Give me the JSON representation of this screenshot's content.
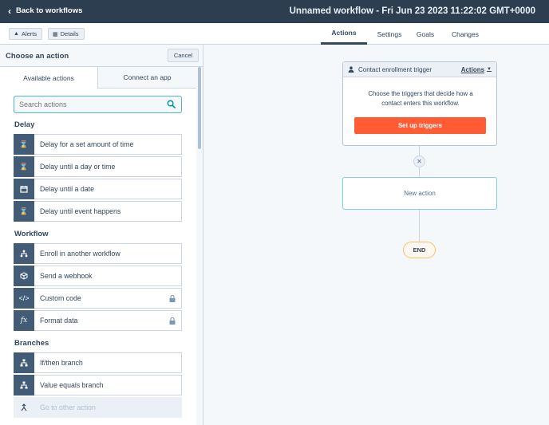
{
  "topbar": {
    "back_label": "Back to workflows",
    "workflow_title": "Unnamed workflow - Fri Jun 23 2023 11:22:02 GMT+0000"
  },
  "subbar": {
    "alerts_label": "Alerts",
    "details_label": "Details",
    "tabs": [
      {
        "label": "Actions",
        "active": true
      },
      {
        "label": "Settings",
        "active": false
      },
      {
        "label": "Goals",
        "active": false
      },
      {
        "label": "Changes",
        "active": false
      }
    ]
  },
  "panel": {
    "title": "Choose an action",
    "cancel_label": "Cancel",
    "tabs": [
      {
        "label": "Available actions",
        "active": true
      },
      {
        "label": "Connect an app",
        "active": false
      }
    ],
    "search_placeholder": "Search actions",
    "sections": [
      {
        "label": "Delay",
        "items": [
          {
            "label": "Delay for a set amount of time",
            "icon": "hourglass-icon",
            "locked": false,
            "disabled": false
          },
          {
            "label": "Delay until a day or time",
            "icon": "hourglass-icon",
            "locked": false,
            "disabled": false
          },
          {
            "label": "Delay until a date",
            "icon": "calendar-icon",
            "locked": false,
            "disabled": false
          },
          {
            "label": "Delay until event happens",
            "icon": "hourglass-icon",
            "locked": false,
            "disabled": false
          }
        ]
      },
      {
        "label": "Workflow",
        "items": [
          {
            "label": "Enroll in another workflow",
            "icon": "workflow-icon",
            "locked": false,
            "disabled": false
          },
          {
            "label": "Send a webhook",
            "icon": "cube-icon",
            "locked": false,
            "disabled": false
          },
          {
            "label": "Custom code",
            "icon": "code-icon",
            "locked": true,
            "disabled": false
          },
          {
            "label": "Format data",
            "icon": "function-icon",
            "locked": true,
            "disabled": false
          }
        ]
      },
      {
        "label": "Branches",
        "items": [
          {
            "label": "If/then branch",
            "icon": "branch-icon",
            "locked": false,
            "disabled": false
          },
          {
            "label": "Value equals branch",
            "icon": "branch-icon",
            "locked": false,
            "disabled": false
          },
          {
            "label": "Go to other action",
            "icon": "goto-icon",
            "locked": false,
            "disabled": true
          }
        ]
      }
    ]
  },
  "canvas": {
    "trigger": {
      "title": "Contact enrollment trigger",
      "actions_label": "Actions",
      "description": "Choose the triggers that decide how a contact enters this workflow.",
      "button_label": "Set up triggers"
    },
    "new_action_label": "New action",
    "end_label": "END"
  },
  "colors": {
    "topbar": "#2d3e50",
    "accent_button": "#ff5c35",
    "focus_border": "#4fb4c7",
    "icon_box": "#425b76",
    "end_border": "#f5c26b"
  }
}
